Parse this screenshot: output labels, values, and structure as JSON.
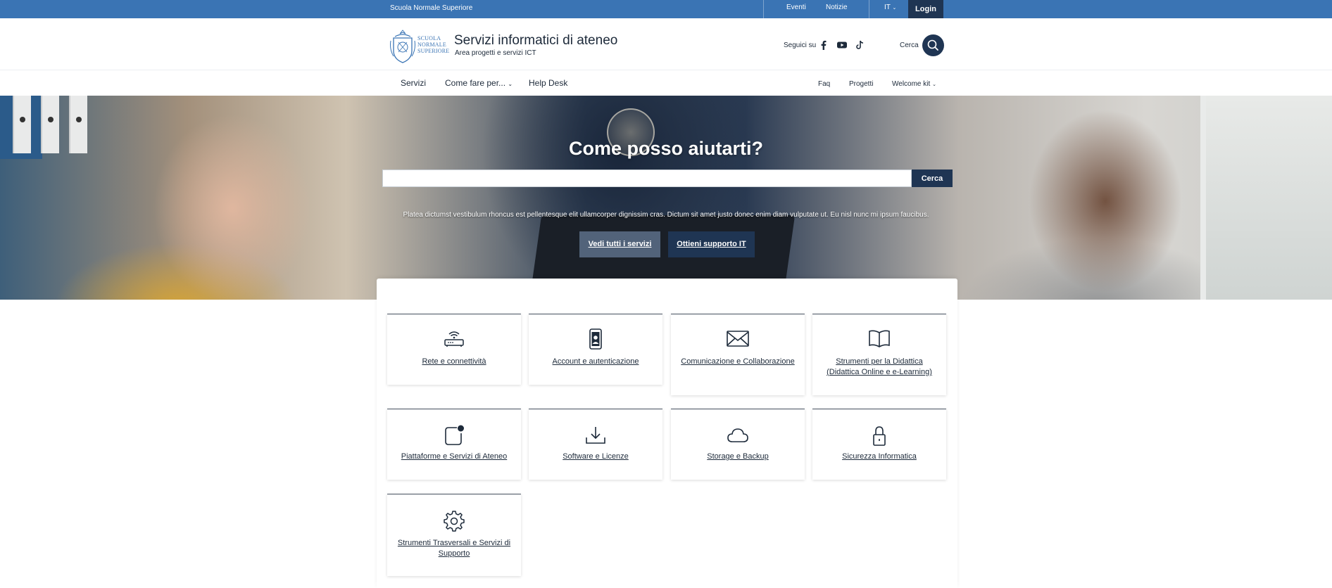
{
  "topbar": {
    "institution": "Scuola Normale Superiore",
    "links": [
      "Eventi",
      "Notizie"
    ],
    "language": "IT",
    "login": "Login"
  },
  "header": {
    "logo_text": [
      "SCUOLA",
      "NORMALE",
      "SUPERIORE"
    ],
    "title": "Servizi informatici di ateneo",
    "subtitle": "Area progetti e servizi ICT",
    "follow_label": "Seguici su",
    "social_icons": [
      "facebook-icon",
      "youtube-icon",
      "tiktok-icon"
    ],
    "search_label": "Cerca"
  },
  "nav": {
    "main": [
      {
        "label": "Servizi"
      },
      {
        "label": "Come fare per...",
        "dropdown": true
      },
      {
        "label": "Help Desk"
      }
    ],
    "secondary": [
      {
        "label": "Faq"
      },
      {
        "label": "Progetti"
      },
      {
        "label": "Welcome kit",
        "dropdown": true
      }
    ]
  },
  "hero": {
    "title": "Come posso aiutarti?",
    "search_value": "",
    "search_button": "Cerca",
    "description": "Platea dictumst vestibulum rhoncus est pellentesque elit ullamcorper dignissim cras. Dictum sit amet justo donec enim diam vulputate ut. Eu nisl nunc mi ipsum faucibus.",
    "btn_all": "Vedi tutti i servizi",
    "btn_support": "Ottieni supporto IT"
  },
  "services": [
    {
      "label": "Rete e connettività",
      "icon": "router-icon"
    },
    {
      "label": "Account e autenticazione",
      "icon": "id-badge-icon"
    },
    {
      "label": "Comunicazione e Collaborazione",
      "icon": "envelope-icon"
    },
    {
      "label": "Strumenti per la Didattica (Didattica Online e e-Learning)",
      "icon": "open-book-icon"
    },
    {
      "label": "Piattaforme e Servizi di Ateneo",
      "icon": "app-notification-icon"
    },
    {
      "label": "Software e Licenze",
      "icon": "download-icon"
    },
    {
      "label": "Storage e Backup",
      "icon": "cloud-icon"
    },
    {
      "label": "Sicurezza Informatica",
      "icon": "padlock-icon"
    },
    {
      "label": "Strumenti Trasversali e Servizi di Supporto",
      "icon": "gear-icon"
    }
  ],
  "colors": {
    "topbar": "#3a74b4",
    "primary_dark": "#1f3553",
    "secondary_button": "#52637a",
    "text": "#1d2a3a"
  }
}
